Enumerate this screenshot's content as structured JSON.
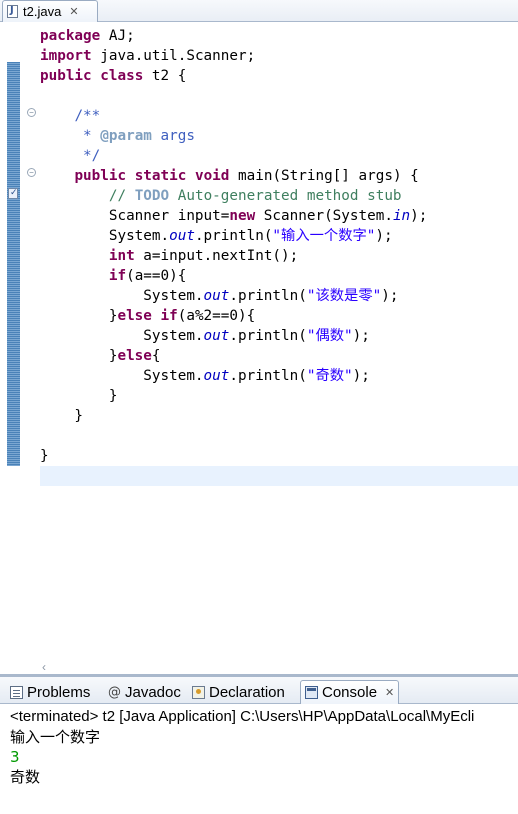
{
  "editor": {
    "tab": {
      "filename": "t2.java",
      "close_glyph": "✕",
      "icon": "java-file-icon"
    },
    "colors": {
      "keyword": "#7f0055",
      "comment": "#3f7f5f",
      "javadoc": "#3f5fbf",
      "string": "#2a00ff",
      "static_field": "#0000c0",
      "current_line_highlight": "#e8f2fe"
    },
    "code_lines": [
      [
        {
          "t": "package",
          "c": "kw"
        },
        {
          "t": " AJ;"
        }
      ],
      [
        {
          "t": "import",
          "c": "kw"
        },
        {
          "t": " java.util.Scanner;"
        }
      ],
      [
        {
          "t": "public",
          "c": "kw"
        },
        {
          "t": " "
        },
        {
          "t": "class",
          "c": "kw"
        },
        {
          "t": " t2 {"
        }
      ],
      [
        {
          "t": ""
        }
      ],
      [
        {
          "t": "    "
        },
        {
          "t": "/**",
          "c": "doc"
        }
      ],
      [
        {
          "t": "     * ",
          "c": "doc"
        },
        {
          "t": "@param",
          "c": "tag"
        },
        {
          "t": " args",
          "c": "doc"
        }
      ],
      [
        {
          "t": "     */",
          "c": "doc"
        }
      ],
      [
        {
          "t": "    "
        },
        {
          "t": "public",
          "c": "kw"
        },
        {
          "t": " "
        },
        {
          "t": "static",
          "c": "kw"
        },
        {
          "t": " "
        },
        {
          "t": "void",
          "c": "kw"
        },
        {
          "t": " main(String[] args) {"
        }
      ],
      [
        {
          "t": "        "
        },
        {
          "t": "// ",
          "c": "cm"
        },
        {
          "t": "TODO",
          "c": "task"
        },
        {
          "t": " Auto-generated method stub",
          "c": "cm"
        }
      ],
      [
        {
          "t": "        Scanner input="
        },
        {
          "t": "new",
          "c": "kw"
        },
        {
          "t": " Scanner(System."
        },
        {
          "t": "in",
          "c": "fld"
        },
        {
          "t": ");"
        }
      ],
      [
        {
          "t": "        System."
        },
        {
          "t": "out",
          "c": "fld"
        },
        {
          "t": ".println("
        },
        {
          "t": "\"输入一个数字\"",
          "c": "str"
        },
        {
          "t": ");"
        }
      ],
      [
        {
          "t": "        "
        },
        {
          "t": "int",
          "c": "kw"
        },
        {
          "t": " a=input.nextInt();"
        }
      ],
      [
        {
          "t": "        "
        },
        {
          "t": "if",
          "c": "kw"
        },
        {
          "t": "(a==0){"
        }
      ],
      [
        {
          "t": "            System."
        },
        {
          "t": "out",
          "c": "fld"
        },
        {
          "t": ".println("
        },
        {
          "t": "\"该数是零\"",
          "c": "str"
        },
        {
          "t": ");"
        }
      ],
      [
        {
          "t": "        }"
        },
        {
          "t": "else",
          "c": "kw"
        },
        {
          "t": " "
        },
        {
          "t": "if",
          "c": "kw"
        },
        {
          "t": "(a%2==0){"
        }
      ],
      [
        {
          "t": "            System."
        },
        {
          "t": "out",
          "c": "fld"
        },
        {
          "t": ".println("
        },
        {
          "t": "\"偶数\"",
          "c": "str"
        },
        {
          "t": ");"
        }
      ],
      [
        {
          "t": "        }"
        },
        {
          "t": "else",
          "c": "kw"
        },
        {
          "t": "{"
        }
      ],
      [
        {
          "t": "            System."
        },
        {
          "t": "out",
          "c": "fld"
        },
        {
          "t": ".println("
        },
        {
          "t": "\"奇数\"",
          "c": "str"
        },
        {
          "t": ");"
        }
      ],
      [
        {
          "t": "        }"
        }
      ],
      [
        {
          "t": "    }"
        }
      ],
      [
        {
          "t": ""
        }
      ],
      [
        {
          "t": "}"
        }
      ],
      [
        {
          "t": ""
        }
      ]
    ]
  },
  "views": {
    "tabs": [
      {
        "label": "Problems",
        "icon": "problems-icon"
      },
      {
        "label": "Javadoc",
        "icon": "javadoc-icon",
        "glyph": "@"
      },
      {
        "label": "Declaration",
        "icon": "declaration-icon"
      },
      {
        "label": "Console",
        "icon": "console-icon",
        "active": true,
        "close_glyph": "✕"
      }
    ]
  },
  "console": {
    "status": "<terminated> t2 [Java Application] C:\\Users\\HP\\AppData\\Local\\MyEcli",
    "output": [
      {
        "text": "输入一个数字",
        "color": "#000000"
      },
      {
        "text": "3",
        "color": "#009900"
      },
      {
        "text": "奇数",
        "color": "#000000"
      }
    ]
  }
}
